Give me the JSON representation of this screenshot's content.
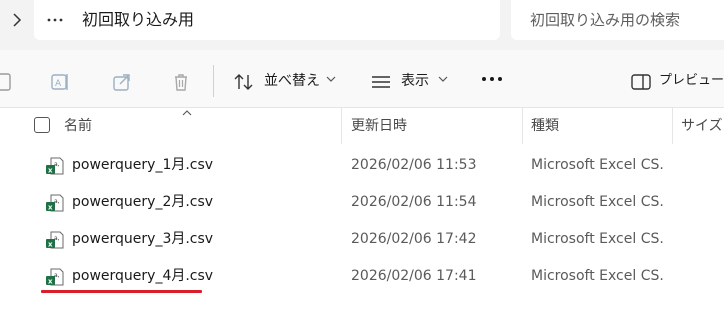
{
  "address": {
    "path": "初回取り込み用",
    "search_placeholder": "初回取り込み用の検索"
  },
  "toolbar": {
    "sort_label": "並べ替え",
    "view_label": "表示",
    "preview_label": "プレビュー"
  },
  "columns": {
    "name": "名前",
    "modified": "更新日時",
    "type": "種類",
    "size": "サイズ"
  },
  "files": [
    {
      "name": "powerquery_1月.csv",
      "modified": "2026/02/06 11:53",
      "type": "Microsoft Excel CS..."
    },
    {
      "name": "powerquery_2月.csv",
      "modified": "2026/02/06 11:54",
      "type": "Microsoft Excel CS..."
    },
    {
      "name": "powerquery_3月.csv",
      "modified": "2026/02/06 17:42",
      "type": "Microsoft Excel CS..."
    },
    {
      "name": "powerquery_4月.csv",
      "modified": "2026/02/06 17:41",
      "type": "Microsoft Excel CS..."
    }
  ],
  "colors": {
    "highlight_underline": "#d8202a",
    "excel_green": "#1e7145"
  }
}
